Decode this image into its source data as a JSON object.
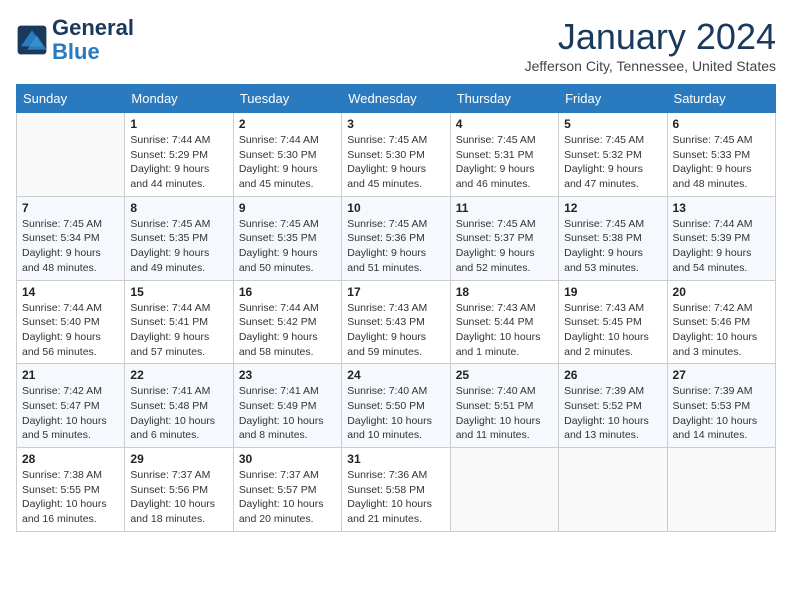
{
  "header": {
    "logo_line1": "General",
    "logo_line2": "Blue",
    "month": "January 2024",
    "location": "Jefferson City, Tennessee, United States"
  },
  "weekdays": [
    "Sunday",
    "Monday",
    "Tuesday",
    "Wednesday",
    "Thursday",
    "Friday",
    "Saturday"
  ],
  "weeks": [
    [
      {
        "day": "",
        "info": ""
      },
      {
        "day": "1",
        "info": "Sunrise: 7:44 AM\nSunset: 5:29 PM\nDaylight: 9 hours\nand 44 minutes."
      },
      {
        "day": "2",
        "info": "Sunrise: 7:44 AM\nSunset: 5:30 PM\nDaylight: 9 hours\nand 45 minutes."
      },
      {
        "day": "3",
        "info": "Sunrise: 7:45 AM\nSunset: 5:30 PM\nDaylight: 9 hours\nand 45 minutes."
      },
      {
        "day": "4",
        "info": "Sunrise: 7:45 AM\nSunset: 5:31 PM\nDaylight: 9 hours\nand 46 minutes."
      },
      {
        "day": "5",
        "info": "Sunrise: 7:45 AM\nSunset: 5:32 PM\nDaylight: 9 hours\nand 47 minutes."
      },
      {
        "day": "6",
        "info": "Sunrise: 7:45 AM\nSunset: 5:33 PM\nDaylight: 9 hours\nand 48 minutes."
      }
    ],
    [
      {
        "day": "7",
        "info": "Sunrise: 7:45 AM\nSunset: 5:34 PM\nDaylight: 9 hours\nand 48 minutes."
      },
      {
        "day": "8",
        "info": "Sunrise: 7:45 AM\nSunset: 5:35 PM\nDaylight: 9 hours\nand 49 minutes."
      },
      {
        "day": "9",
        "info": "Sunrise: 7:45 AM\nSunset: 5:35 PM\nDaylight: 9 hours\nand 50 minutes."
      },
      {
        "day": "10",
        "info": "Sunrise: 7:45 AM\nSunset: 5:36 PM\nDaylight: 9 hours\nand 51 minutes."
      },
      {
        "day": "11",
        "info": "Sunrise: 7:45 AM\nSunset: 5:37 PM\nDaylight: 9 hours\nand 52 minutes."
      },
      {
        "day": "12",
        "info": "Sunrise: 7:45 AM\nSunset: 5:38 PM\nDaylight: 9 hours\nand 53 minutes."
      },
      {
        "day": "13",
        "info": "Sunrise: 7:44 AM\nSunset: 5:39 PM\nDaylight: 9 hours\nand 54 minutes."
      }
    ],
    [
      {
        "day": "14",
        "info": "Sunrise: 7:44 AM\nSunset: 5:40 PM\nDaylight: 9 hours\nand 56 minutes."
      },
      {
        "day": "15",
        "info": "Sunrise: 7:44 AM\nSunset: 5:41 PM\nDaylight: 9 hours\nand 57 minutes."
      },
      {
        "day": "16",
        "info": "Sunrise: 7:44 AM\nSunset: 5:42 PM\nDaylight: 9 hours\nand 58 minutes."
      },
      {
        "day": "17",
        "info": "Sunrise: 7:43 AM\nSunset: 5:43 PM\nDaylight: 9 hours\nand 59 minutes."
      },
      {
        "day": "18",
        "info": "Sunrise: 7:43 AM\nSunset: 5:44 PM\nDaylight: 10 hours\nand 1 minute."
      },
      {
        "day": "19",
        "info": "Sunrise: 7:43 AM\nSunset: 5:45 PM\nDaylight: 10 hours\nand 2 minutes."
      },
      {
        "day": "20",
        "info": "Sunrise: 7:42 AM\nSunset: 5:46 PM\nDaylight: 10 hours\nand 3 minutes."
      }
    ],
    [
      {
        "day": "21",
        "info": "Sunrise: 7:42 AM\nSunset: 5:47 PM\nDaylight: 10 hours\nand 5 minutes."
      },
      {
        "day": "22",
        "info": "Sunrise: 7:41 AM\nSunset: 5:48 PM\nDaylight: 10 hours\nand 6 minutes."
      },
      {
        "day": "23",
        "info": "Sunrise: 7:41 AM\nSunset: 5:49 PM\nDaylight: 10 hours\nand 8 minutes."
      },
      {
        "day": "24",
        "info": "Sunrise: 7:40 AM\nSunset: 5:50 PM\nDaylight: 10 hours\nand 10 minutes."
      },
      {
        "day": "25",
        "info": "Sunrise: 7:40 AM\nSunset: 5:51 PM\nDaylight: 10 hours\nand 11 minutes."
      },
      {
        "day": "26",
        "info": "Sunrise: 7:39 AM\nSunset: 5:52 PM\nDaylight: 10 hours\nand 13 minutes."
      },
      {
        "day": "27",
        "info": "Sunrise: 7:39 AM\nSunset: 5:53 PM\nDaylight: 10 hours\nand 14 minutes."
      }
    ],
    [
      {
        "day": "28",
        "info": "Sunrise: 7:38 AM\nSunset: 5:55 PM\nDaylight: 10 hours\nand 16 minutes."
      },
      {
        "day": "29",
        "info": "Sunrise: 7:37 AM\nSunset: 5:56 PM\nDaylight: 10 hours\nand 18 minutes."
      },
      {
        "day": "30",
        "info": "Sunrise: 7:37 AM\nSunset: 5:57 PM\nDaylight: 10 hours\nand 20 minutes."
      },
      {
        "day": "31",
        "info": "Sunrise: 7:36 AM\nSunset: 5:58 PM\nDaylight: 10 hours\nand 21 minutes."
      },
      {
        "day": "",
        "info": ""
      },
      {
        "day": "",
        "info": ""
      },
      {
        "day": "",
        "info": ""
      }
    ]
  ]
}
